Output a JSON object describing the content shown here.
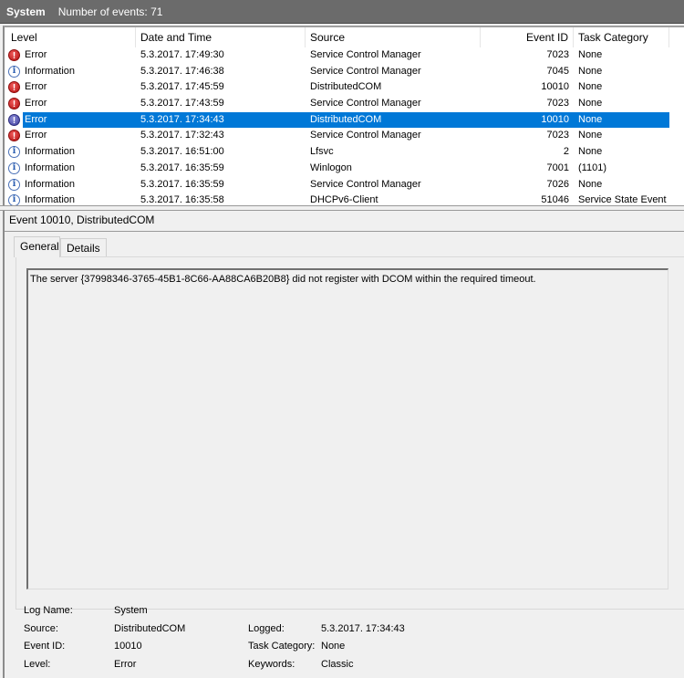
{
  "titlebar": {
    "log_name": "System",
    "count_label": "Number of events: 71"
  },
  "grid": {
    "columns": [
      "Level",
      "Date and Time",
      "Source",
      "Event ID",
      "Task Category"
    ],
    "rows": [
      {
        "level": "Error",
        "icon": "error-icon",
        "date": "5.3.2017. 17:49:30",
        "source": "Service Control Manager",
        "id": "7023",
        "category": "None",
        "selected": false
      },
      {
        "level": "Information",
        "icon": "info-icon",
        "date": "5.3.2017. 17:46:38",
        "source": "Service Control Manager",
        "id": "7045",
        "category": "None",
        "selected": false
      },
      {
        "level": "Error",
        "icon": "error-icon",
        "date": "5.3.2017. 17:45:59",
        "source": "DistributedCOM",
        "id": "10010",
        "category": "None",
        "selected": false
      },
      {
        "level": "Error",
        "icon": "error-icon",
        "date": "5.3.2017. 17:43:59",
        "source": "Service Control Manager",
        "id": "7023",
        "category": "None",
        "selected": false
      },
      {
        "level": "Error",
        "icon": "error-icon",
        "date": "5.3.2017. 17:34:43",
        "source": "DistributedCOM",
        "id": "10010",
        "category": "None",
        "selected": true
      },
      {
        "level": "Error",
        "icon": "error-icon",
        "date": "5.3.2017. 17:32:43",
        "source": "Service Control Manager",
        "id": "7023",
        "category": "None",
        "selected": false
      },
      {
        "level": "Information",
        "icon": "info-icon",
        "date": "5.3.2017. 16:51:00",
        "source": "Lfsvc",
        "id": "2",
        "category": "None",
        "selected": false
      },
      {
        "level": "Information",
        "icon": "info-icon",
        "date": "5.3.2017. 16:35:59",
        "source": "Winlogon",
        "id": "7001",
        "category": "(1101)",
        "selected": false
      },
      {
        "level": "Information",
        "icon": "info-icon",
        "date": "5.3.2017. 16:35:59",
        "source": "Service Control Manager",
        "id": "7026",
        "category": "None",
        "selected": false
      },
      {
        "level": "Information",
        "icon": "info-icon",
        "date": "5.3.2017. 16:35:58",
        "source": "DHCPv6-Client",
        "id": "51046",
        "category": "Service State Event",
        "selected": false
      }
    ]
  },
  "detail": {
    "title": "Event 10010, DistributedCOM",
    "tabs": [
      "General",
      "Details"
    ],
    "active_tab": "General",
    "message": "The server {37998346-3765-45B1-8C66-AA88CA6B20B8} did not register with DCOM within the required timeout.",
    "properties": {
      "log_name_label": "Log Name:",
      "log_name": "System",
      "source_label": "Source:",
      "source": "DistributedCOM",
      "logged_label": "Logged:",
      "logged": "5.3.2017. 17:34:43",
      "event_id_label": "Event ID:",
      "event_id": "10010",
      "task_category_label": "Task Category:",
      "task_category": "None",
      "level_label": "Level:",
      "level": "Error",
      "keywords_label": "Keywords:",
      "keywords": "Classic"
    }
  },
  "colors": {
    "selection": "#0078d7",
    "titlebar": "#6b6b6b"
  }
}
